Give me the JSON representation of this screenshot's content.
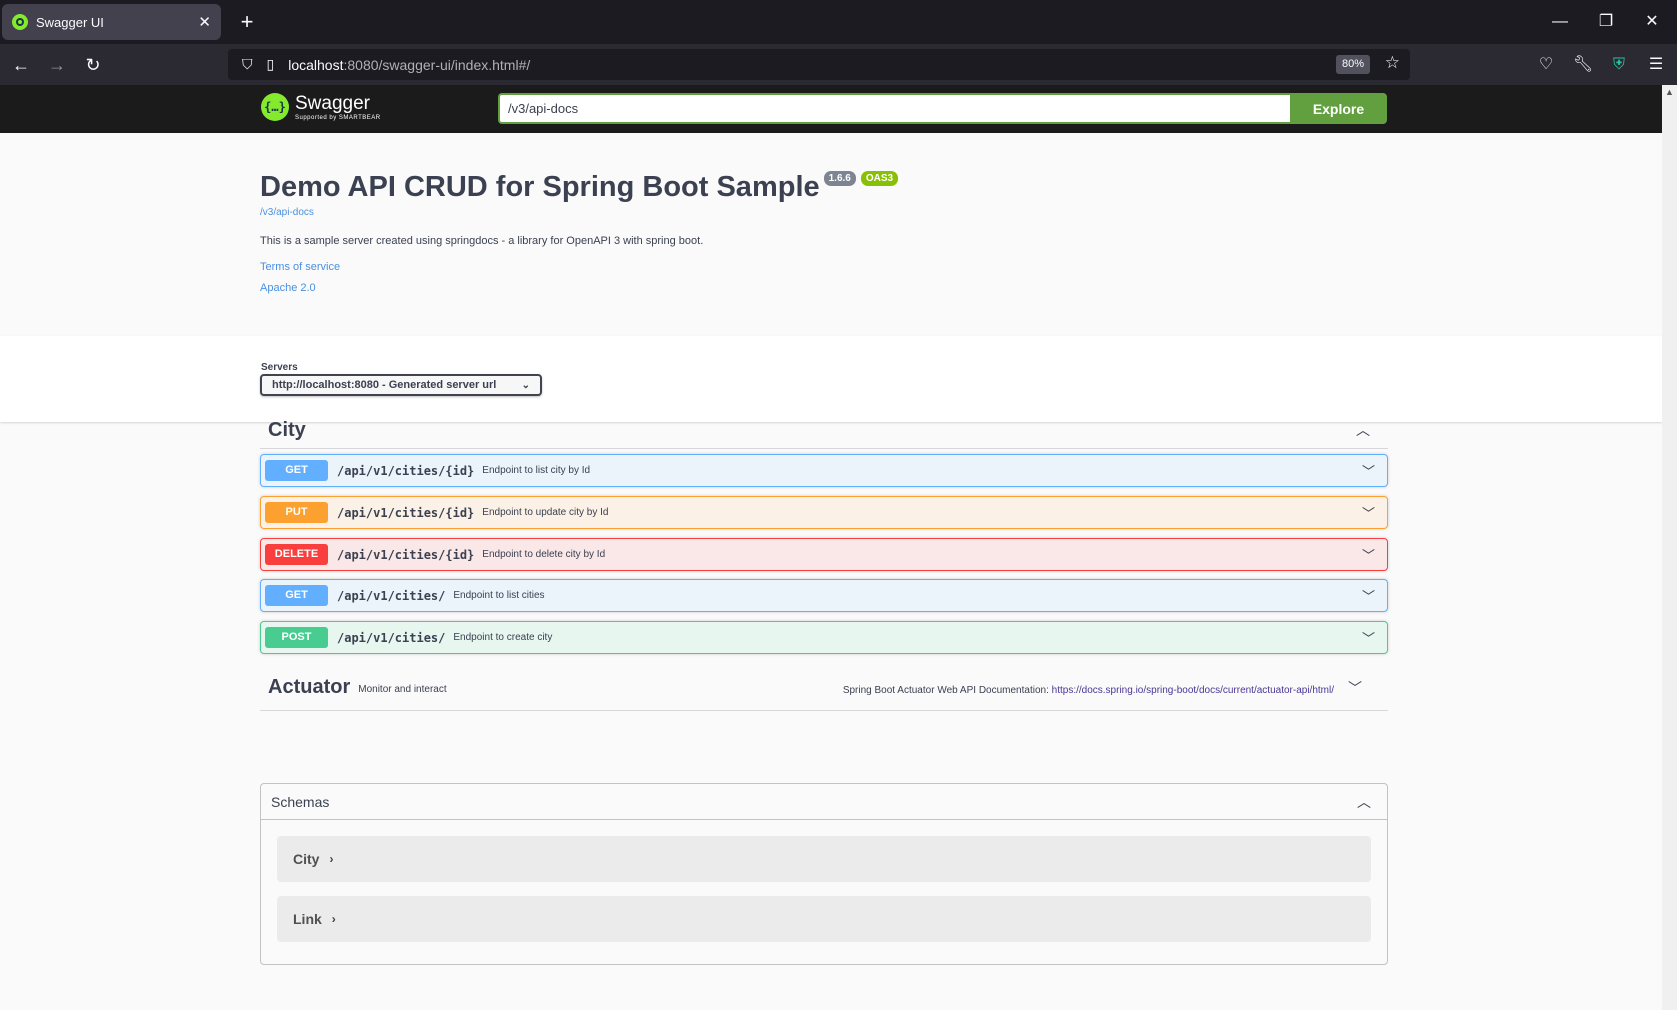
{
  "browser": {
    "tab_title": "Swagger UI",
    "url_host": "localhost",
    "url_rest": ":8080/swagger-ui/index.html#/",
    "zoom": "80%"
  },
  "topbar": {
    "logo_text": "Swagger",
    "logo_sub": "Supported by SMARTBEAR",
    "explore_value": "/v3/api-docs",
    "explore_label": "Explore"
  },
  "info": {
    "title": "Demo API CRUD for Spring Boot Sample",
    "version": "1.6.6",
    "oas": "OAS3",
    "url": "/v3/api-docs",
    "description": "This is a sample server created using springdocs - a library for OpenAPI 3 with spring boot.",
    "terms": "Terms of service",
    "license": "Apache 2.0"
  },
  "servers": {
    "label": "Servers",
    "selected": "http://localhost:8080 - Generated server url"
  },
  "tags": {
    "city": {
      "name": "City",
      "operations": [
        {
          "method": "GET",
          "path": "/api/v1/cities/{id}",
          "summary": "Endpoint to list city by Id"
        },
        {
          "method": "PUT",
          "path": "/api/v1/cities/{id}",
          "summary": "Endpoint to update city by Id"
        },
        {
          "method": "DELETE",
          "path": "/api/v1/cities/{id}",
          "summary": "Endpoint to delete city by Id"
        },
        {
          "method": "GET",
          "path": "/api/v1/cities/",
          "summary": "Endpoint to list cities"
        },
        {
          "method": "POST",
          "path": "/api/v1/cities/",
          "summary": "Endpoint to create city"
        }
      ]
    },
    "actuator": {
      "name": "Actuator",
      "description": "Monitor and interact",
      "ext_doc_label": "Spring Boot Actuator Web API Documentation:",
      "ext_doc_url": "https://docs.spring.io/spring-boot/docs/current/actuator-api/html/"
    }
  },
  "schemas": {
    "title": "Schemas",
    "models": [
      "City",
      "Link"
    ]
  },
  "colors": {
    "get": "#61affe",
    "put": "#fca130",
    "delete": "#f93e3e",
    "post": "#49cc90",
    "explore": "#62a03f"
  }
}
